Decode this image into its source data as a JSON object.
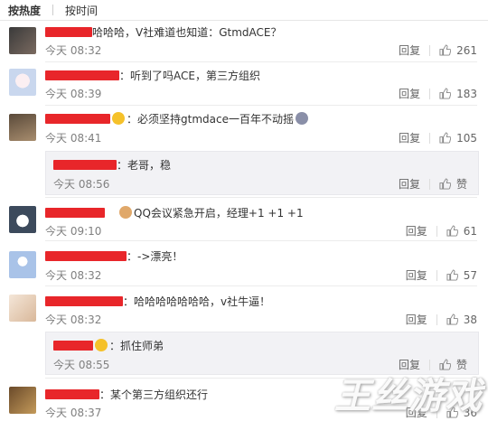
{
  "tabs": [
    "按热度",
    "按时间"
  ],
  "labels": {
    "reply": "回复",
    "like_word": "赞"
  },
  "colors": {
    "redaction": "#e8262a",
    "sub_bg": "#f2f2f5"
  },
  "comments": [
    {
      "text": "哈哈哈，V社难道也知道：GtmdACE？",
      "time": "今天 08:32",
      "likes": "261",
      "avatar": "dark-face-avatar"
    },
    {
      "text": "：听到了吗ACE，第三方组织",
      "time": "今天 08:39",
      "likes": "183",
      "avatar": "anime-girl-avatar"
    },
    {
      "text": "：必须坚持gtmdace一百年不动摇",
      "time": "今天 08:41",
      "likes": "105",
      "avatar": "man-face-avatar"
    },
    {
      "text": "QQ会议紧急开启，经理+1 +1 +1",
      "time": "今天 09:10",
      "likes": "61",
      "avatar": "husky-dog-avatar"
    },
    {
      "text": "：->漂亮！",
      "time": "今天 08:32",
      "likes": "57",
      "avatar": "default-user-avatar"
    },
    {
      "text": "：哈哈哈哈哈哈哈，v社牛逼！",
      "time": "今天 08:32",
      "likes": "38",
      "avatar": "cartoon-avatar"
    },
    {
      "text": "：某个第三方组织还行",
      "time": "今天 08:37",
      "likes": "36",
      "avatar": "brown-avatar"
    }
  ],
  "subreplies": [
    {
      "text": "：老哥，稳",
      "time": "今天 08:56"
    },
    {
      "text": "：抓住师弟",
      "time": "今天 08:55"
    }
  ],
  "watermark": "王丝游戏"
}
